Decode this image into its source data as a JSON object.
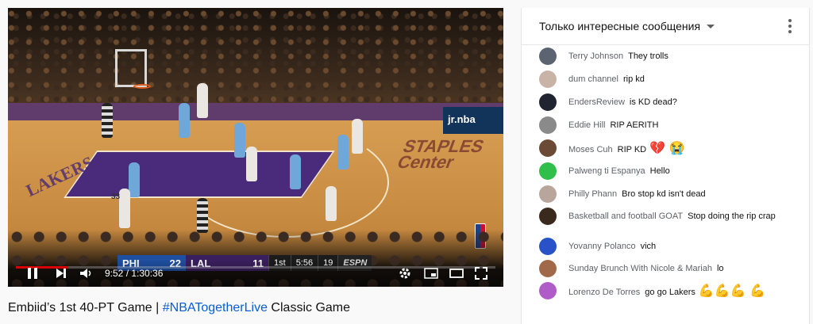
{
  "video": {
    "current_time": "9:52",
    "duration": "1:30:36",
    "time_text": "9:52 / 1:30:36",
    "progress_fraction": 0.109,
    "scorebug": {
      "home_team": "PHI",
      "home_score": "22",
      "away_team": "LAL",
      "away_score": "11",
      "quarter": "1st",
      "clock": "5:56",
      "shot_clock": "19",
      "network": "ESPN"
    },
    "court_text": {
      "staples": "STAPLES Center",
      "lakers": "LAKERS",
      "jrnba": "jr.nba",
      "jersey": "33"
    }
  },
  "title": {
    "prefix": "Embiid’s 1st 40-PT Game | ",
    "hashtag": "#NBATogetherLive",
    "suffix": " Classic Game"
  },
  "chat": {
    "mode_label": "Только интересные сообщения",
    "messages": [
      {
        "author": "Terry Johnson",
        "text": "They trolls",
        "avatar_color": "#5b6470"
      },
      {
        "author": "dum channel",
        "text": "rip kd",
        "avatar_color": "#c9b3a6"
      },
      {
        "author": "EndersReview",
        "text": "is KD dead?",
        "avatar_color": "#1f2430"
      },
      {
        "author": "Eddie Hill",
        "text": "RIP AERITH",
        "avatar_color": "#8a8a8a"
      },
      {
        "author": "Moses Cuh",
        "text": "RIP KD",
        "emoji": "💔 😭",
        "avatar_color": "#6b4a36"
      },
      {
        "author": "Palweng ti Espanya",
        "text": "Hello",
        "avatar_color": "#2fbf4a"
      },
      {
        "author": "Philly Phann",
        "text": "Bro stop kd isn't dead",
        "avatar_color": "#b8a69c"
      },
      {
        "author": "Basketball and football GOAT",
        "text": "Stop doing the rip crap",
        "avatar_color": "#3a2a1e"
      },
      {
        "author": "Yovanny Polanco",
        "text": "vich",
        "avatar_color": "#2952c8"
      },
      {
        "author": "Sunday Brunch With Nicole & Mariah",
        "text": "lo",
        "avatar_color": "#a06a4a"
      },
      {
        "author": "Lorenzo De Torres",
        "text": "go go Lakers",
        "emoji": "💪💪💪 💪",
        "avatar_color": "#b05cc8"
      }
    ]
  }
}
